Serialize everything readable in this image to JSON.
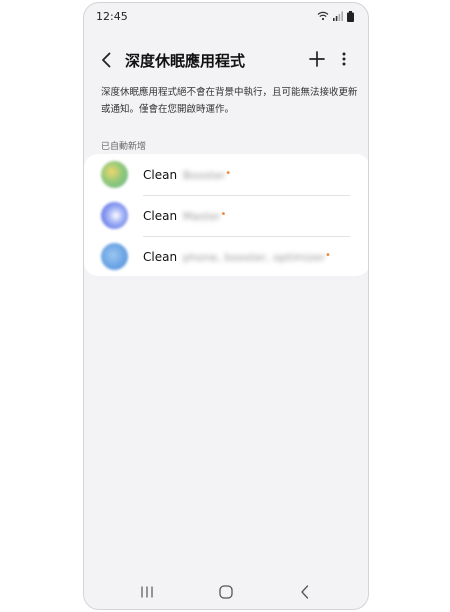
{
  "status_bar": {
    "time": "12:45",
    "icons": [
      "wifi-icon",
      "signal-icon",
      "battery-icon"
    ]
  },
  "app_bar": {
    "title": "深度休眠應用程式",
    "back_icon": "back-arrow-icon",
    "add_icon": "plus-icon",
    "more_icon": "more-vertical-icon"
  },
  "description": "深度休眠應用程式絕不會在背景中執行，且可能無法接收更新或通知。僅會在您開啟時運作。",
  "section_header": "已自動新增",
  "apps": [
    {
      "name_visible": "Clean",
      "name_blurred": "Booster",
      "icon": "app-icon-green"
    },
    {
      "name_visible": "Clean",
      "name_blurred": "Master",
      "icon": "app-icon-blue"
    },
    {
      "name_visible": "Clean",
      "name_blurred": "phone, booster, optimizer",
      "icon": "app-icon-teal"
    }
  ],
  "nav_bar": {
    "icons": [
      "recents-icon",
      "home-icon",
      "back-icon"
    ]
  },
  "colors": {
    "background": "#f3f3f6",
    "card": "#ffffff",
    "accent_dot": "#f08a3c"
  }
}
